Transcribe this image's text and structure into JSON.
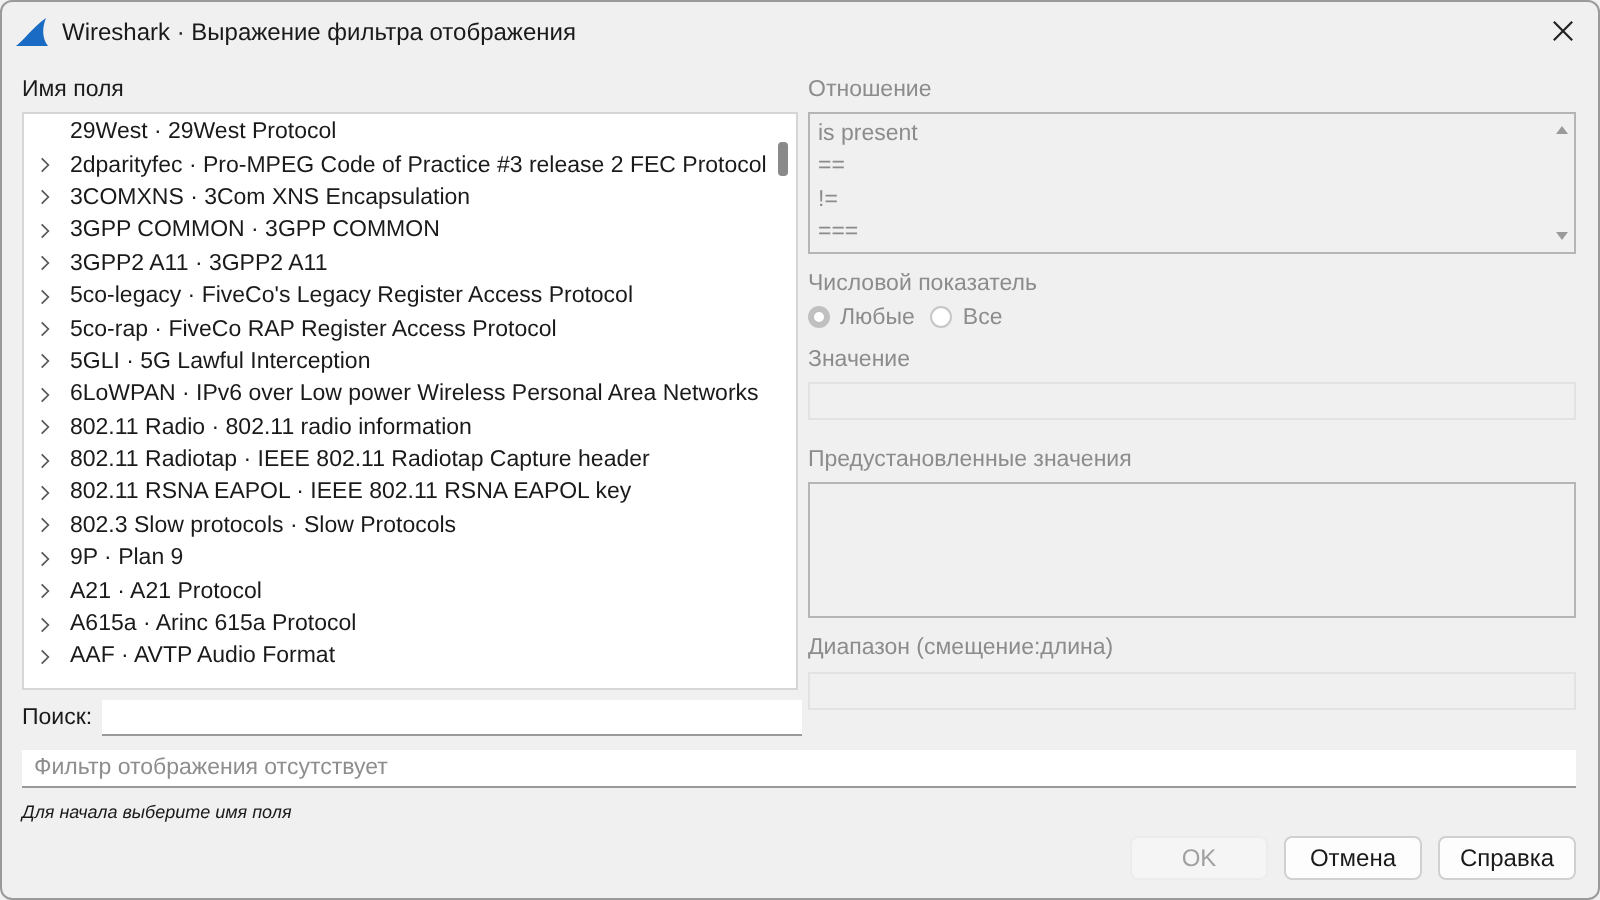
{
  "window": {
    "title": "Wireshark · Выражение фильтра отображения"
  },
  "field_name": {
    "label": "Имя поля",
    "items": [
      {
        "label": "29West · 29West Protocol",
        "expandable": false
      },
      {
        "label": "2dparityfec · Pro-MPEG Code of Practice #3 release 2 FEC Protocol",
        "expandable": true
      },
      {
        "label": "3COMXNS · 3Com XNS Encapsulation",
        "expandable": true
      },
      {
        "label": "3GPP COMMON · 3GPP COMMON",
        "expandable": true
      },
      {
        "label": "3GPP2 A11 · 3GPP2 A11",
        "expandable": true
      },
      {
        "label": "5co-legacy · FiveCo's Legacy Register Access Protocol",
        "expandable": true
      },
      {
        "label": "5co-rap · FiveCo RAP Register Access Protocol",
        "expandable": true
      },
      {
        "label": "5GLI · 5G Lawful Interception",
        "expandable": true
      },
      {
        "label": "6LoWPAN · IPv6 over Low power Wireless Personal Area Networks",
        "expandable": true
      },
      {
        "label": "802.11 Radio · 802.11 radio information",
        "expandable": true
      },
      {
        "label": "802.11 Radiotap · IEEE 802.11 Radiotap Capture header",
        "expandable": true
      },
      {
        "label": "802.11 RSNA EAPOL · IEEE 802.11 RSNA EAPOL key",
        "expandable": true
      },
      {
        "label": "802.3 Slow protocols · Slow Protocols",
        "expandable": true
      },
      {
        "label": "9P · Plan 9",
        "expandable": true
      },
      {
        "label": "A21 · A21 Protocol",
        "expandable": true
      },
      {
        "label": "A615a · Arinc 615a Protocol",
        "expandable": true
      },
      {
        "label": "AAF · AVTP Audio Format",
        "expandable": true
      }
    ]
  },
  "search": {
    "label": "Поиск:"
  },
  "relation": {
    "label": "Отношение",
    "disabled": true,
    "items": [
      "is present",
      "==",
      "!=",
      "==="
    ]
  },
  "quantifier": {
    "label": "Числовой показатель",
    "disabled": true,
    "options": [
      {
        "label": "Любые",
        "selected": true
      },
      {
        "label": "Все",
        "selected": false
      }
    ]
  },
  "value": {
    "label": "Значение",
    "disabled": true
  },
  "predefined_values": {
    "label": "Предустановленные значения",
    "disabled": true
  },
  "range": {
    "label": "Диапазон (смещение:длина)",
    "disabled": true
  },
  "filter": {
    "placeholder": "Фильтр отображения отсутствует"
  },
  "status": "Для начала выберите имя поля",
  "buttons": [
    {
      "label": "OK",
      "disabled": true
    },
    {
      "label": "Отмена",
      "disabled": false
    },
    {
      "label": "Справка",
      "disabled": false
    }
  ]
}
